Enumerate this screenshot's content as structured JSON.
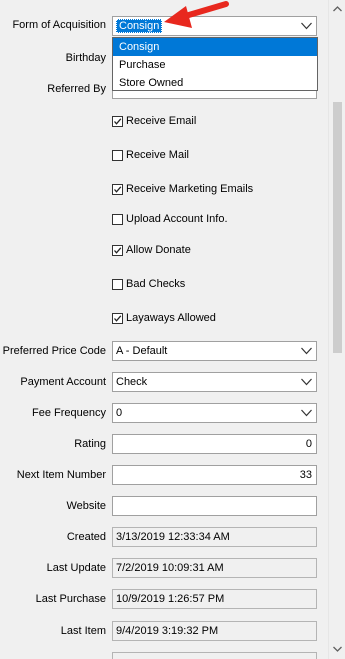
{
  "form": {
    "acquisition": {
      "label": "Form of Acquisition",
      "value": "Consign",
      "options": [
        "Consign",
        "Purchase",
        "Store Owned"
      ]
    },
    "birthday_label": "Birthday",
    "referred_by_label": "Referred By",
    "checkboxes": [
      {
        "label": "Receive Email",
        "checked": true
      },
      {
        "label": "Receive Mail",
        "checked": false
      },
      {
        "label": "Receive Marketing Emails",
        "checked": true
      },
      {
        "label": "Upload Account Info.",
        "checked": false
      },
      {
        "label": "Allow Donate",
        "checked": true
      },
      {
        "label": "Bad Checks",
        "checked": false
      },
      {
        "label": "Layaways Allowed",
        "checked": true
      }
    ],
    "preferred_price_code": {
      "label": "Preferred Price Code",
      "value": "A - Default"
    },
    "payment_account": {
      "label": "Payment Account",
      "value": "Check"
    },
    "fee_frequency": {
      "label": "Fee Frequency",
      "value": "0"
    },
    "rating": {
      "label": "Rating",
      "value": "0"
    },
    "next_item_number": {
      "label": "Next Item Number",
      "value": "33"
    },
    "website": {
      "label": "Website",
      "value": ""
    },
    "created": {
      "label": "Created",
      "value": "3/13/2019 12:33:34 AM"
    },
    "last_update": {
      "label": "Last Update",
      "value": "7/2/2019 10:09:31 AM"
    },
    "last_purchase": {
      "label": "Last Purchase",
      "value": "10/9/2019 1:26:57 PM"
    },
    "last_item": {
      "label": "Last Item",
      "value": "9/4/2019 3:19:32 PM"
    }
  },
  "colors": {
    "highlight": "#0078d7",
    "arrow": "#e8281e"
  }
}
